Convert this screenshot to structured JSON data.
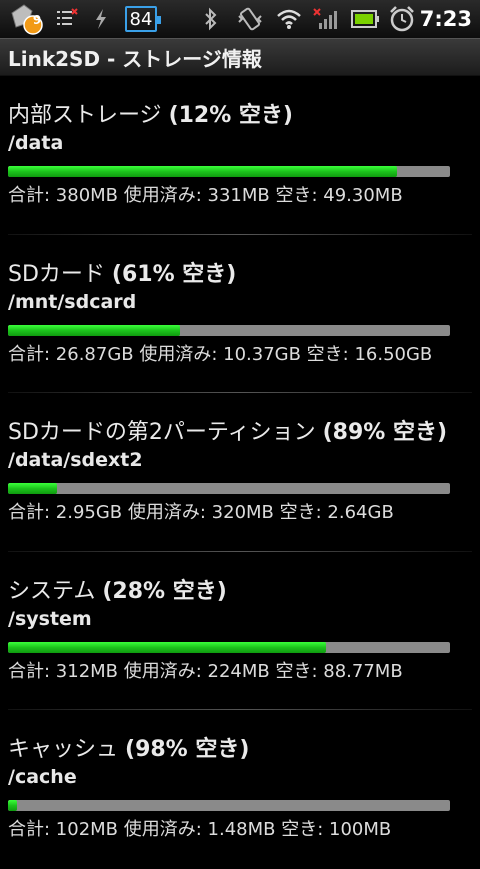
{
  "status_bar": {
    "notification_count": "9",
    "battery_level": "84",
    "time": "7:23"
  },
  "title_bar": {
    "title": "Link2SD - ストレージ情報"
  },
  "storage": [
    {
      "name": "内部ストレージ",
      "free_percent": "(12% 空き)",
      "path": "/data",
      "used_fraction": 0.88,
      "details": "合計: 380MB 使用済み: 331MB 空き: 49.30MB"
    },
    {
      "name": "SDカード",
      "free_percent": "(61% 空き)",
      "path": "/mnt/sdcard",
      "used_fraction": 0.39,
      "details": "合計: 26.87GB 使用済み: 10.37GB 空き: 16.50GB"
    },
    {
      "name": "SDカードの第2パーティション",
      "free_percent": "(89% 空き)",
      "path": "/data/sdext2",
      "used_fraction": 0.11,
      "details": "合計: 2.95GB 使用済み: 320MB 空き: 2.64GB"
    },
    {
      "name": "システム",
      "free_percent": "(28% 空き)",
      "path": "/system",
      "used_fraction": 0.72,
      "details": "合計: 312MB 使用済み: 224MB 空き: 88.77MB"
    },
    {
      "name": "キャッシュ",
      "free_percent": "(98% 空き)",
      "path": "/cache",
      "used_fraction": 0.02,
      "details": "合計: 102MB 使用済み: 1.48MB 空き: 100MB"
    }
  ]
}
